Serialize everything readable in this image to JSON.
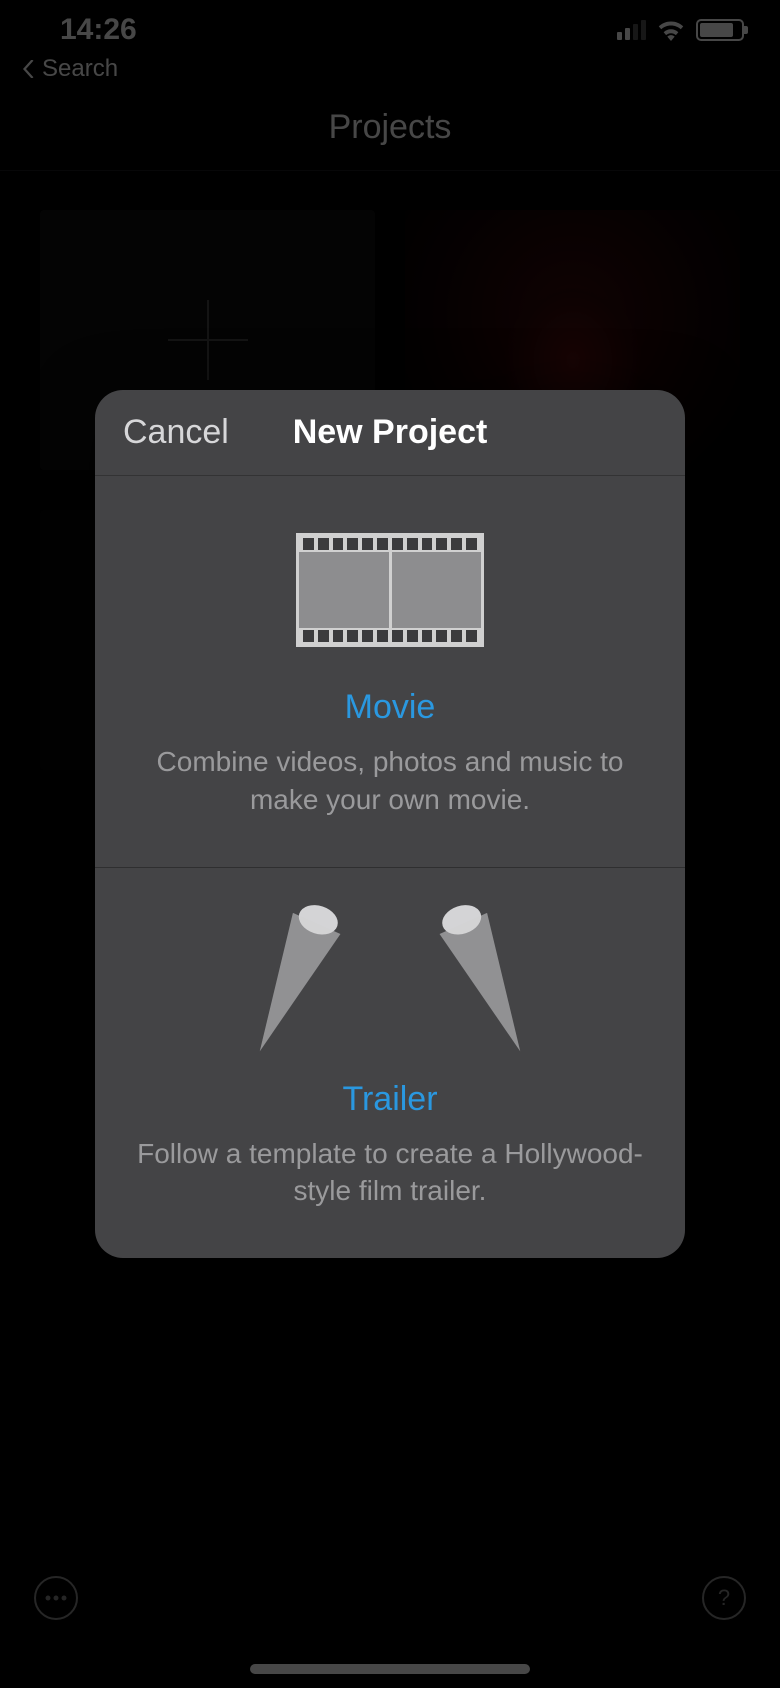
{
  "status": {
    "time": "14:26"
  },
  "breadcrumb": {
    "label": "Search"
  },
  "nav": {
    "title": "Projects"
  },
  "modal": {
    "cancel": "Cancel",
    "title": "New Project",
    "options": [
      {
        "title": "Movie",
        "desc": "Combine videos, photos and music to make your own movie."
      },
      {
        "title": "Trailer",
        "desc": "Follow a template to create a Hollywood-style film trailer."
      }
    ]
  },
  "colors": {
    "accent": "#2a98e0"
  }
}
